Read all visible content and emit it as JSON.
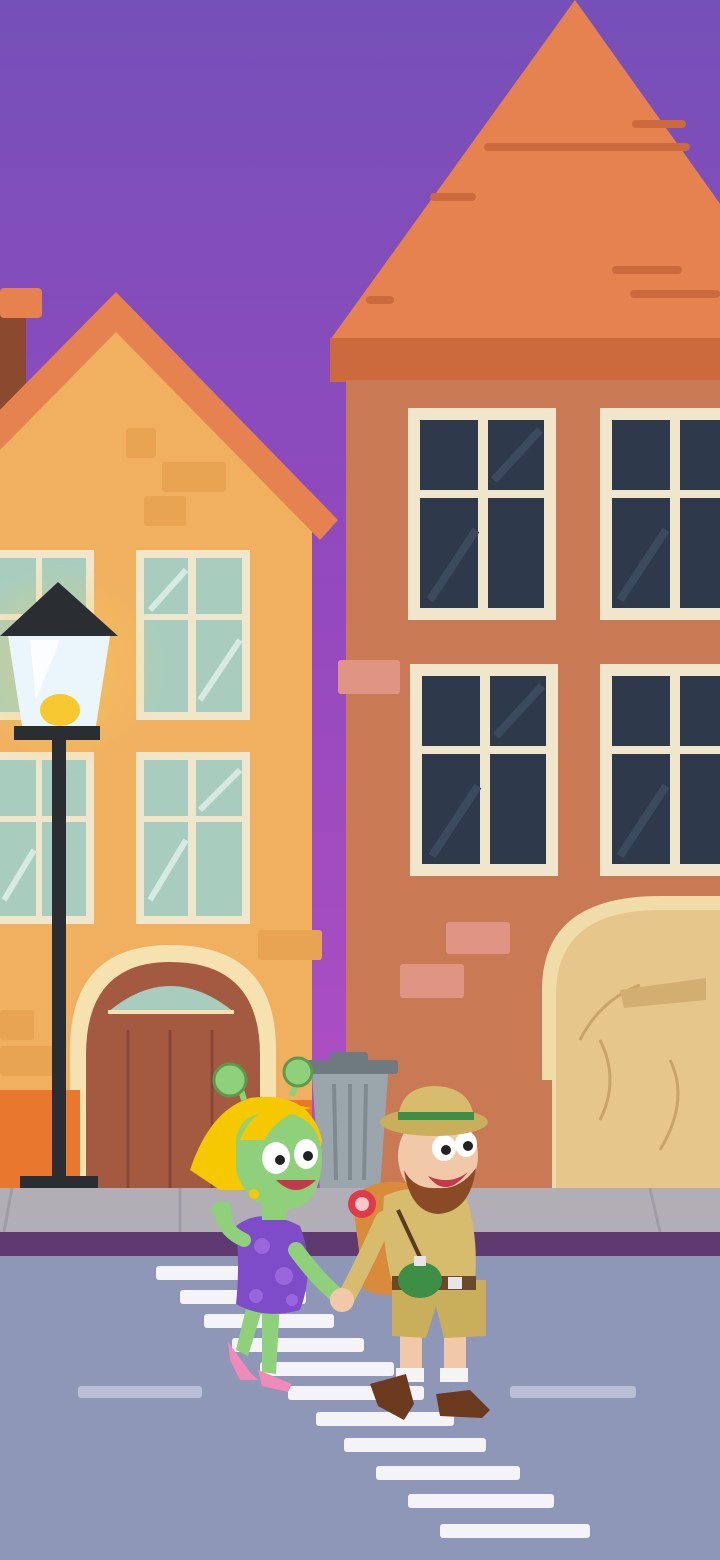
{
  "scene": {
    "colors": {
      "sky_top": "#7550B8",
      "sky_bottom": "#B24FC4",
      "roof_orange": "#E5824F",
      "tall_house_wall": "#C97A55",
      "left_house_wall": "#F0B060",
      "window_frame": "#EFE6CC",
      "window_glass_dark": "#2E3A4C",
      "window_glass_light": "#A8CDBF",
      "door_wood": "#A45A40",
      "door_light": "#E7C68C",
      "sidewalk": "#B2AEB6",
      "curb": "#5E3A70",
      "road": "#8E97B8",
      "crosswalk": "#F4F4F8",
      "lamp_post": "#2A2E33",
      "lamp_glow": "#F8D060"
    }
  },
  "characters": {
    "alien_woman": {
      "skin": "#8FD07A",
      "hair": "#F5C800",
      "dress": "#7E4CC8",
      "shoes": "#F08AB8"
    },
    "explorer_man": {
      "outfit": "#D6BC6C",
      "beard": "#8A4A26",
      "backpack": "#D98A3A",
      "canteen": "#3E8F46",
      "boots": "#6B3A1E"
    }
  }
}
